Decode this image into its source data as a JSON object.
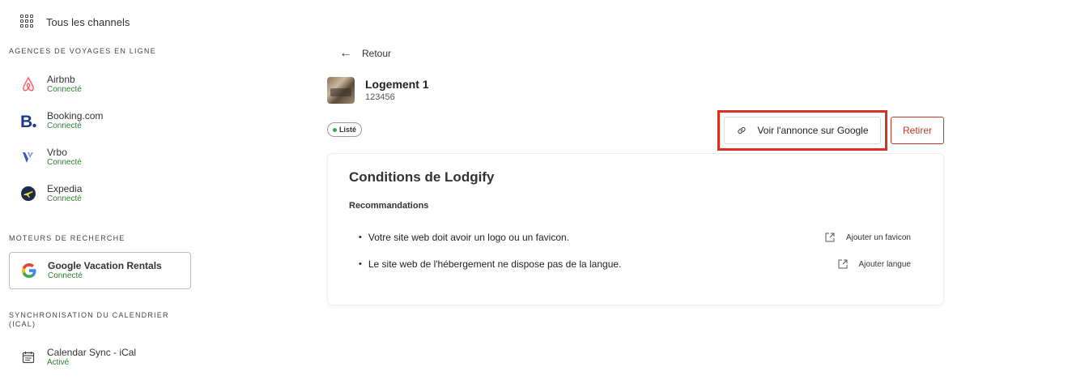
{
  "sidebar": {
    "all_channels": "Tous les channels",
    "ota_section": "AGENCES DE VOYAGES EN LIGNE",
    "channels": [
      {
        "name": "Airbnb",
        "status": "Connecté",
        "icon": "airbnb-icon"
      },
      {
        "name": "Booking.com",
        "status": "Connecté",
        "icon": "booking-icon"
      },
      {
        "name": "Vrbo",
        "status": "Connecté",
        "icon": "vrbo-icon"
      },
      {
        "name": "Expedia",
        "status": "Connecté",
        "icon": "expedia-icon"
      }
    ],
    "search_section": "MOTEURS DE RECHERCHE",
    "google": {
      "name": "Google Vacation Rentals",
      "status": "Connecté",
      "icon": "google-icon"
    },
    "ical_section": "SYNCHRONISATION DU CALENDRIER (ICAL)",
    "ical": {
      "name": "Calendar Sync - iCal",
      "status": "Activé",
      "icon": "calendar-icon"
    }
  },
  "main": {
    "back_label": "Retour",
    "listing": {
      "title": "Logement 1",
      "id": "123456"
    },
    "status_badge": "Listé",
    "view_google_button": "Voir l'annonce sur Google",
    "remove_button": "Retirer",
    "card": {
      "title": "Conditions de Lodgify",
      "subtitle": "Recommandations",
      "items": [
        {
          "text": "Votre site web doit avoir un logo ou un favicon.",
          "action": "Ajouter un favicon"
        },
        {
          "text": "Le site web de l'hébergement ne dispose pas de la langue.",
          "action": "Ajouter langue"
        }
      ]
    }
  },
  "colors": {
    "connected": "#2f7d32",
    "danger": "#c0392b",
    "highlight": "#d9301f",
    "listed_dot": "#3aa35a"
  }
}
